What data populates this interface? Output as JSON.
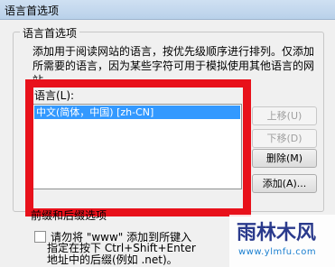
{
  "window": {
    "title": "语言首选项"
  },
  "group": {
    "legend": "语言首选项",
    "description_lines": [
      "添加用于阅读网站的语言，按优先级顺序进行排列。仅添加",
      "所需要的语言，因为某些字符可用于模拟使用其他语言的网",
      "站。"
    ],
    "languages_label": "语言(L):",
    "languages": [
      "中文(简体，中国) [zh-CN]"
    ]
  },
  "buttons": {
    "move_up": "上移(U)",
    "move_down": "下移(D)",
    "remove": "删除(M)",
    "add": "添加(A)..."
  },
  "prefix_section": {
    "title": "前缀和后缀选项",
    "checkbox_label": "请勿将 \"www\" 添加到所键入",
    "note_lines": [
      "指定在按下 Ctrl+Shift+Enter",
      "地址中的后缀(例如 .net)。"
    ]
  },
  "watermark": {
    "logo": "雨林木风",
    "url": "www.ylmfu.com"
  },
  "colors": {
    "highlight": "#3399ff",
    "annotation_red": "#e8111b"
  }
}
